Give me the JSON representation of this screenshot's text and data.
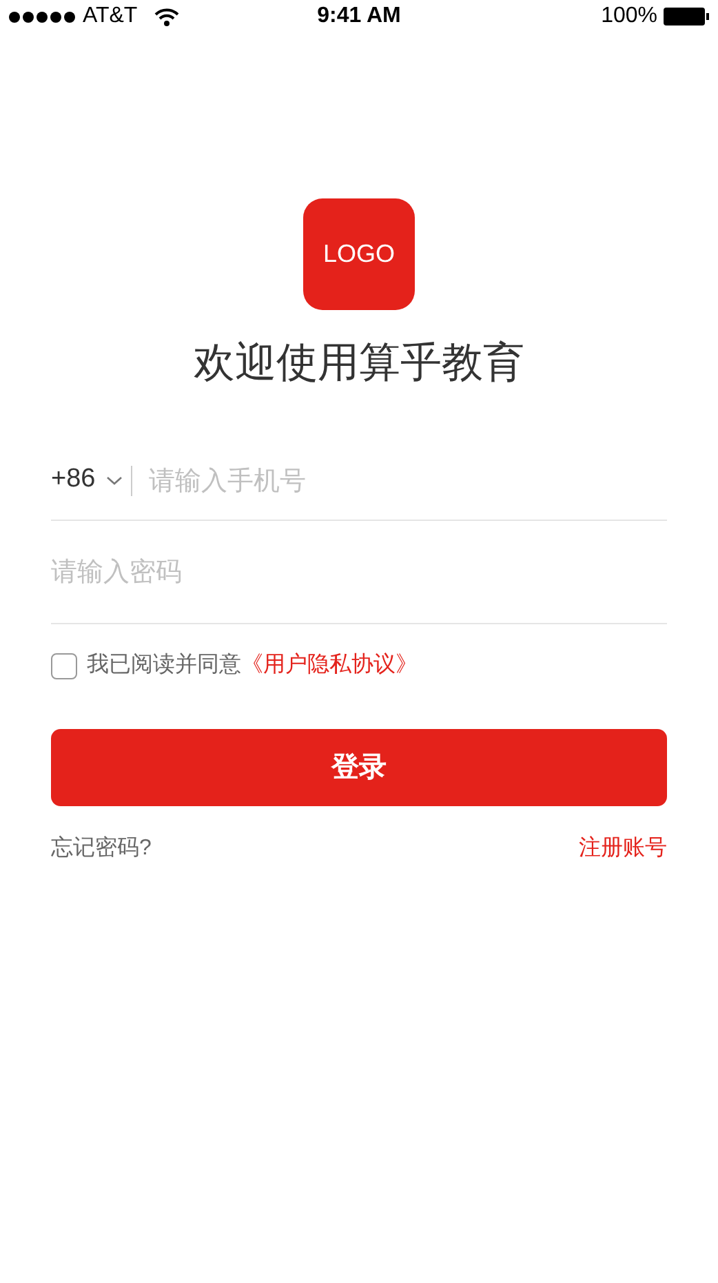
{
  "status_bar": {
    "carrier": "AT&T",
    "time": "9:41 AM",
    "battery": "100%"
  },
  "logo": {
    "text": "LOGO"
  },
  "title": "欢迎使用算乎教育",
  "phone": {
    "country_code": "+86",
    "placeholder": "请输入手机号"
  },
  "password": {
    "placeholder": "请输入密码"
  },
  "agreement": {
    "checked": false,
    "text": "我已阅读并同意",
    "link": "《用户隐私协议》"
  },
  "login_button": "登录",
  "forgot_link": "忘记密码?",
  "register_link": "注册账号"
}
